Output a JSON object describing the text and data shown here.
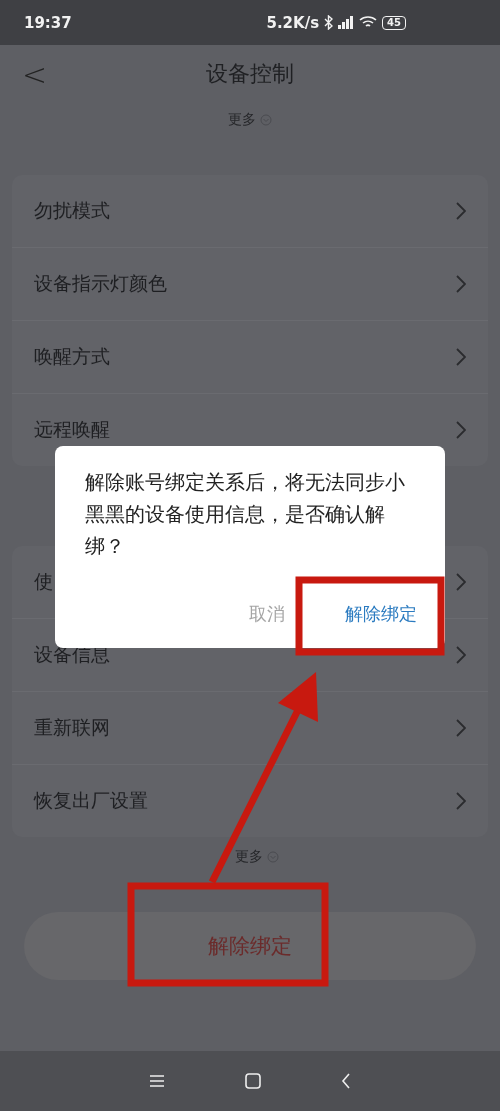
{
  "status_bar": {
    "time": "19:37",
    "speed": "5.2K/s",
    "battery": "45"
  },
  "header": {
    "back": "<",
    "title": "设备控制"
  },
  "more_top": "更多",
  "groups": [
    {
      "items": [
        {
          "label": "勿扰模式"
        },
        {
          "label": "设备指示灯颜色"
        },
        {
          "label": "唤醒方式"
        },
        {
          "label": "远程唤醒"
        }
      ]
    },
    {
      "items": [
        {
          "label": "使"
        },
        {
          "label": "设备信息"
        },
        {
          "label": "重新联网"
        },
        {
          "label": "恢复出厂设置"
        }
      ]
    }
  ],
  "more_bottom": "更多",
  "unbind_button": "解除绑定",
  "dialog": {
    "message": "解除账号绑定关系后，将无法同步小黑黑的设备使用信息，是否确认解绑？",
    "buttons": [
      {
        "label": "取消",
        "kind": "cancel"
      },
      {
        "label": "解除绑定",
        "kind": "confirm"
      }
    ]
  }
}
